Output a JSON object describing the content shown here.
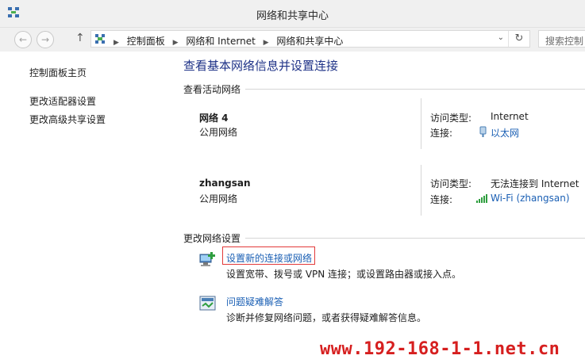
{
  "window": {
    "title": "网络和共享中心"
  },
  "nav": {
    "breadcrumbs": [
      "控制面板",
      "网络和 Internet",
      "网络和共享中心"
    ],
    "search_placeholder": "搜索控制"
  },
  "sidebar": {
    "items": [
      {
        "label": "控制面板主页"
      },
      {
        "label": "更改适配器设置"
      },
      {
        "label": "更改高级共享设置"
      }
    ]
  },
  "main": {
    "title": "查看基本网络信息并设置连接",
    "active_networks_header": "查看活动网络",
    "networks": [
      {
        "name": "网络  4",
        "type": "公用网络",
        "access_label": "访问类型:",
        "access_value": "Internet",
        "conn_label": "连接:",
        "conn_value": "以太网",
        "conn_icon": "ethernet-icon"
      },
      {
        "name": "zhangsan",
        "type": "公用网络",
        "access_label": "访问类型:",
        "access_value": "无法连接到 Internet",
        "conn_label": "连接:",
        "conn_value": "Wi-Fi (zhangsan)",
        "conn_icon": "wifi-signal-icon"
      }
    ],
    "change_settings_header": "更改网络设置",
    "tasks": [
      {
        "link": "设置新的连接或网络",
        "desc": "设置宽带、拨号或 VPN 连接；或设置路由器或接入点。",
        "icon": "new-connection-icon"
      },
      {
        "link": "问题疑难解答",
        "desc": "诊断并修复网络问题，或者获得疑难解答信息。",
        "icon": "troubleshoot-icon"
      }
    ]
  },
  "watermark": "www.192-168-1-1.net.cn",
  "colors": {
    "link": "#1a5fb4",
    "title": "#1e3287",
    "highlight": "#e23a3a",
    "watermark": "#d61f1f"
  }
}
